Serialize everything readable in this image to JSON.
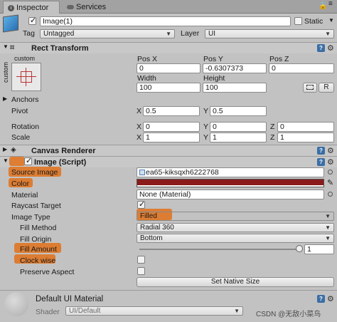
{
  "tabs": [
    {
      "label": "Inspector"
    },
    {
      "label": "Services"
    }
  ],
  "object": {
    "name": "Image(1)",
    "static_label": "Static",
    "tag_label": "Tag",
    "tag_value": "Untagged",
    "layer_label": "Layer",
    "layer_value": "UI"
  },
  "rect_transform": {
    "title": "Rect Transform",
    "anchor_preset_top": "custom",
    "anchor_preset_side": "custom",
    "pos_x_label": "Pos X",
    "pos_y_label": "Pos Y",
    "pos_z_label": "Pos Z",
    "pos_x": "0",
    "pos_y": "-0.6307373",
    "pos_z": "0",
    "width_label": "Width",
    "height_label": "Height",
    "width": "100",
    "height": "100",
    "r_button": "R",
    "anchors_label": "Anchors",
    "pivot_label": "Pivot",
    "pivot_x": "0.5",
    "pivot_y": "0.5",
    "rotation_label": "Rotation",
    "rotation_x": "0",
    "rotation_y": "0",
    "rotation_z": "0",
    "scale_label": "Scale",
    "scale_x": "1",
    "scale_y": "1",
    "scale_z": "1",
    "x": "X",
    "y": "Y",
    "z": "Z"
  },
  "canvas_renderer": {
    "title": "Canvas Renderer"
  },
  "image_script": {
    "title": "Image (Script)",
    "source_image_label": "Source Image",
    "source_image_value": "ea65-kiksqxh6222768",
    "color_label": "Color",
    "color_value": "#8b1a1a",
    "material_label": "Material",
    "material_value": "None (Material)",
    "raycast_label": "Raycast Target",
    "image_type_label": "Image Type",
    "image_type_value": "Filled",
    "fill_method_label": "Fill Method",
    "fill_method_value": "Radial 360",
    "fill_origin_label": "Fill Origin",
    "fill_origin_value": "Bottom",
    "fill_amount_label": "Fill Amount",
    "fill_amount_value": "1",
    "clockwise_label": "Clock wise",
    "preserve_aspect_label": "Preserve Aspect",
    "set_native_size": "Set Native Size"
  },
  "material": {
    "title": "Default UI Material",
    "shader_label": "Shader",
    "shader_value": "UI/Default"
  },
  "watermark": "CSDN @无敌小菜鸟",
  "colors": {
    "highlight": "#e0711a",
    "accent_blue": "#3b6ea5"
  }
}
